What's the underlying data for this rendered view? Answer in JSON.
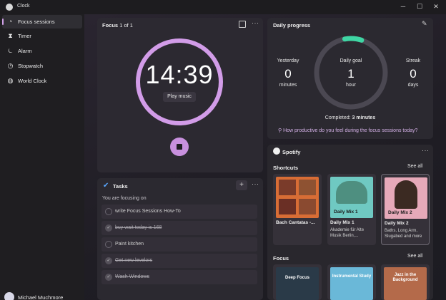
{
  "app": {
    "title": "Clock",
    "icon": "clock-icon"
  },
  "window_controls": {
    "minimize": "─",
    "maximize": "☐",
    "close": "✕"
  },
  "sidebar": {
    "items": [
      {
        "label": "Focus sessions",
        "icon": "focus-icon",
        "glyph": "◔",
        "active": true
      },
      {
        "label": "Timer",
        "icon": "hourglass-icon",
        "glyph": "⧗",
        "active": false
      },
      {
        "label": "Alarm",
        "icon": "bell-icon",
        "glyph": "⏾",
        "active": false
      },
      {
        "label": "Stopwatch",
        "icon": "stopwatch-icon",
        "glyph": "◷",
        "active": false
      },
      {
        "label": "World Clock",
        "icon": "globe-icon",
        "glyph": "◍",
        "active": false
      }
    ],
    "user_name": "Michael Muchmore"
  },
  "focus": {
    "title": "Focus",
    "counter": "1 of 1",
    "time": "14:39",
    "play_music": "Play music",
    "ring_color": "#d29ce8",
    "accent": "#c890de"
  },
  "tasks": {
    "title": "Tasks",
    "focusing_label": "You are focusing on",
    "add_glyph": "+",
    "items": [
      {
        "text": "write Focus Sessions How-To",
        "done": false
      },
      {
        "text": "buy wait today is 168",
        "done": true
      },
      {
        "text": "Paint kitchen",
        "done": false
      },
      {
        "text": "Get new levelors",
        "done": true
      },
      {
        "text": "Wash Windows",
        "done": true
      }
    ]
  },
  "daily_progress": {
    "title": "Daily progress",
    "yesterday": {
      "label": "Yesterday",
      "value": "0",
      "unit": "minutes"
    },
    "goal": {
      "label": "Daily goal",
      "value": "1",
      "unit": "hour"
    },
    "streak": {
      "label": "Streak",
      "value": "0",
      "unit": "days"
    },
    "completed_label": "Completed:",
    "completed_value": "3 minutes",
    "question": "How productive do you feel during the focus sessions today?",
    "progress_fraction": 0.05,
    "progress_color": "#3fd6a4"
  },
  "spotify": {
    "brand": "Spotify",
    "shortcuts_label": "Shortcuts",
    "see_all": "See all",
    "shortcuts": [
      {
        "title": "Bach Cantatas -...",
        "subtitle": "",
        "color": "#d86d35"
      },
      {
        "title": "Daily Mix 1",
        "subtitle": "Akademie für Alte Musik Berlin,...",
        "color": "#6fc9c2",
        "overlay": "Daily Mix 1"
      },
      {
        "title": "Daily Mix 2",
        "subtitle": "Baths, Long Arm, Slugabed and more",
        "color": "#e6a9b9",
        "overlay": "Daily Mix 2"
      }
    ],
    "focus_label": "Focus",
    "focus_see_all": "See all",
    "focus_playlists": [
      {
        "title": "Deep Focus",
        "color": "#2a3a48"
      },
      {
        "title": "Instrumental Study",
        "color": "#6ab8d8"
      },
      {
        "title": "Jazz in the Background",
        "color": "#b46a4a"
      }
    ]
  }
}
